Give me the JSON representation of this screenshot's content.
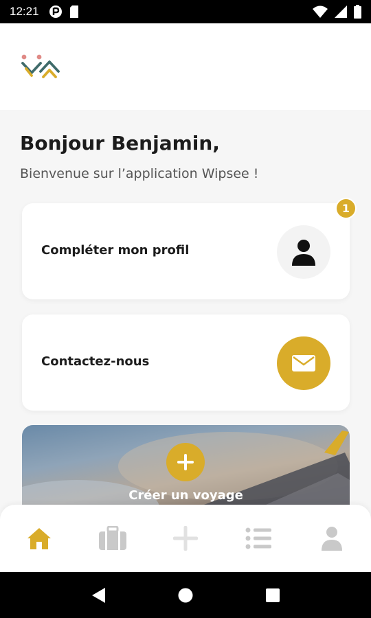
{
  "status_bar": {
    "time": "12:21",
    "icons": [
      "notification-icon",
      "sim-icon",
      "wifi-icon",
      "signal-icon",
      "battery-icon"
    ]
  },
  "header": {
    "logo": "wipsee-logo"
  },
  "greeting": {
    "title": "Bonjour Benjamin,",
    "subtitle": "Bienvenue sur l’application Wipsee !"
  },
  "cards": [
    {
      "label": "Compléter mon profil",
      "icon": "user-icon",
      "badge": "1"
    },
    {
      "label": "Contactez-nous",
      "icon": "mail-icon"
    }
  ],
  "trip_banner": {
    "label": "Créer un voyage",
    "icon": "plus-icon"
  },
  "bottom_nav": {
    "items": [
      {
        "name": "home",
        "icon": "home-icon",
        "active": true
      },
      {
        "name": "trips",
        "icon": "suitcase-icon",
        "active": false
      },
      {
        "name": "add",
        "icon": "plus-icon",
        "active": false
      },
      {
        "name": "list",
        "icon": "list-icon",
        "active": false
      },
      {
        "name": "profile",
        "icon": "user-icon",
        "active": false
      }
    ]
  },
  "colors": {
    "accent": "#d9ac2a",
    "text": "#1c1c1c",
    "muted": "#555555",
    "inactive_icon": "#c9c9c9",
    "background": "#f6f6f6"
  }
}
